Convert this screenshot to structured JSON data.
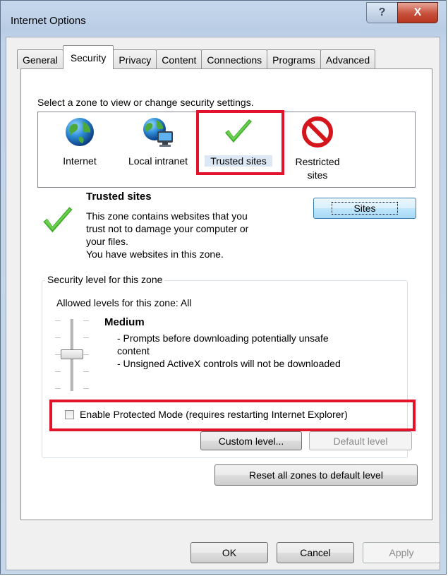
{
  "window": {
    "title": "Internet Options",
    "help_glyph": "?",
    "close_glyph": "X"
  },
  "tabs": [
    {
      "label": "General",
      "active": false
    },
    {
      "label": "Security",
      "active": true
    },
    {
      "label": "Privacy",
      "active": false
    },
    {
      "label": "Content",
      "active": false
    },
    {
      "label": "Connections",
      "active": false
    },
    {
      "label": "Programs",
      "active": false
    },
    {
      "label": "Advanced",
      "active": false
    }
  ],
  "security": {
    "instruction": "Select a zone to view or change security settings.",
    "zones": [
      {
        "label": "Internet",
        "icon": "globe-icon"
      },
      {
        "label": "Local intranet",
        "icon": "intranet-icon"
      },
      {
        "label": "Trusted sites",
        "icon": "checkmark-icon",
        "selected": true
      },
      {
        "label_line1": "Restricted",
        "label_line2": "sites",
        "icon": "restricted-icon"
      }
    ],
    "zone_info": {
      "title": "Trusted sites",
      "desc_lines": [
        "This zone contains websites that you",
        "trust not to damage your computer or",
        "your files.",
        "You have websites in this zone."
      ],
      "sites_button": "Sites"
    },
    "level_group": {
      "label": "Security level for this zone",
      "allowed": "Allowed levels for this zone: All",
      "level_name": "Medium",
      "bullets": [
        "- Prompts before downloading potentially unsafe",
        "content",
        "- Unsigned ActiveX controls will not be downloaded"
      ],
      "slider_level": "Medium",
      "protected_mode_label": "Enable Protected Mode (requires restarting Internet Explorer)",
      "protected_mode_checked": false,
      "custom_level_button": "Custom level...",
      "default_level_button": "Default level"
    },
    "reset_button": "Reset all zones to default level"
  },
  "footer": {
    "ok": "OK",
    "cancel": "Cancel",
    "apply": "Apply"
  },
  "colors": {
    "highlight_box": "#e2142b",
    "check_green": "#3fae2a",
    "restricted_red": "#d5151c"
  }
}
